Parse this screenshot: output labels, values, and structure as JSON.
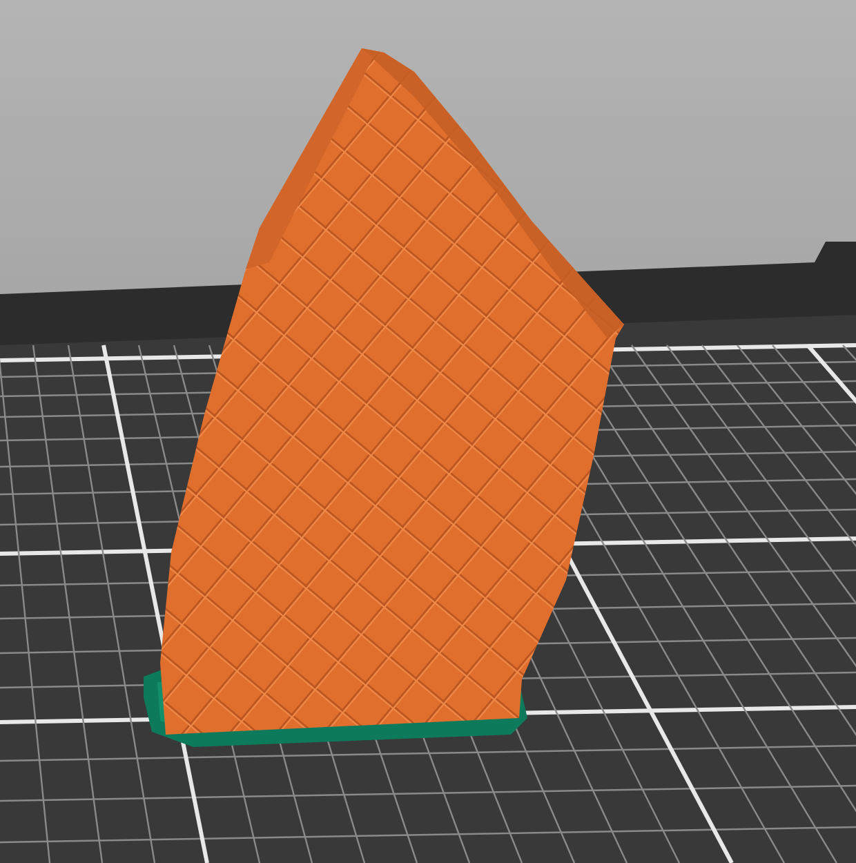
{
  "viewport": {
    "kind": "slicer-preview"
  }
}
